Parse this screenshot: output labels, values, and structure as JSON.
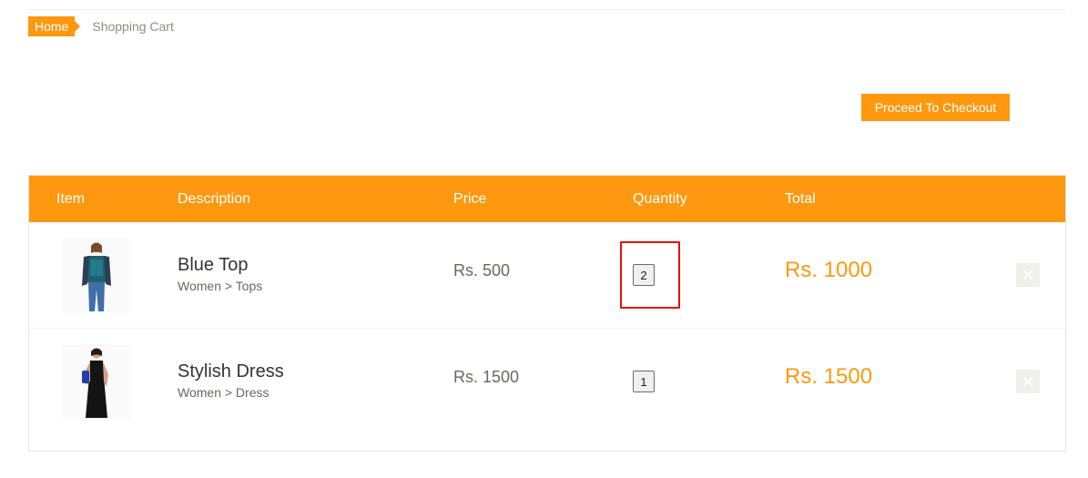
{
  "breadcrumb": {
    "home": "Home",
    "current": "Shopping Cart"
  },
  "checkout_button": "Proceed To Checkout",
  "table": {
    "headers": [
      "Item",
      "Description",
      "Price",
      "Quantity",
      "Total"
    ],
    "rows": [
      {
        "name": "Blue Top",
        "category": "Women > Tops",
        "price": "Rs. 500",
        "quantity": "2",
        "total": "Rs. 1000",
        "image": "woman-in-blue-top"
      },
      {
        "name": "Stylish Dress",
        "category": "Women > Dress",
        "price": "Rs. 1500",
        "quantity": "1",
        "total": "Rs. 1500",
        "image": "woman-in-black-dress"
      }
    ]
  },
  "icons": {
    "remove": "close-icon"
  },
  "colors": {
    "accent": "#fe980f",
    "highlight": "#e80e0e",
    "remove_bg": "#f0f0e9"
  }
}
